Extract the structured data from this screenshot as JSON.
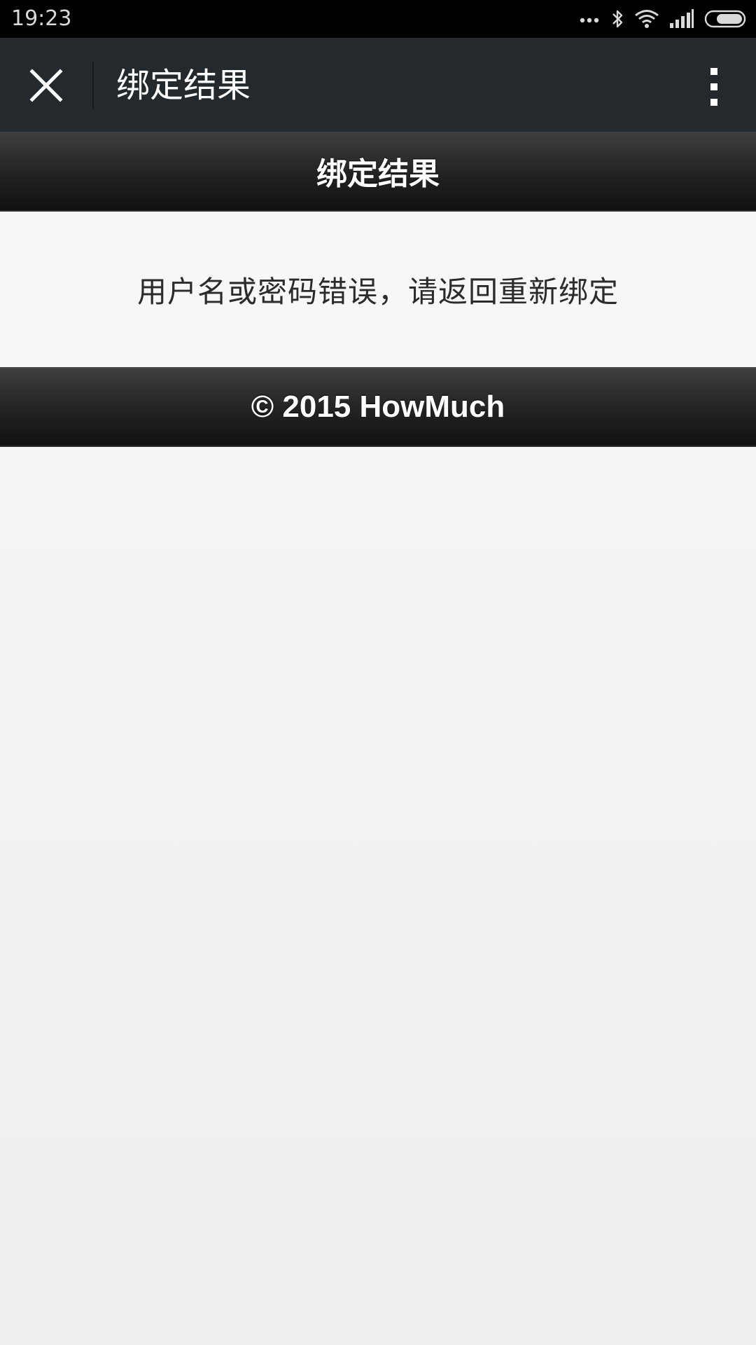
{
  "status_bar": {
    "time": "19:23",
    "icons": [
      "more-dots-icon",
      "bluetooth-icon",
      "wifi-icon",
      "signal-icon",
      "battery-icon"
    ]
  },
  "app_bar": {
    "close_icon": "close-icon",
    "title": "绑定结果",
    "more_icon": "more-vertical-icon"
  },
  "page_header": {
    "title": "绑定结果"
  },
  "content": {
    "message": "用户名或密码错误，请返回重新绑定"
  },
  "footer": {
    "copyright": "© 2015 HowMuch"
  },
  "colors": {
    "status_bar_bg": "#000000",
    "app_bar_bg": "#23292d",
    "band_bg": "#222222",
    "page_bg": "#f7f7f7",
    "text_dark": "#2b2b2b",
    "text_light": "#ffffff"
  }
}
